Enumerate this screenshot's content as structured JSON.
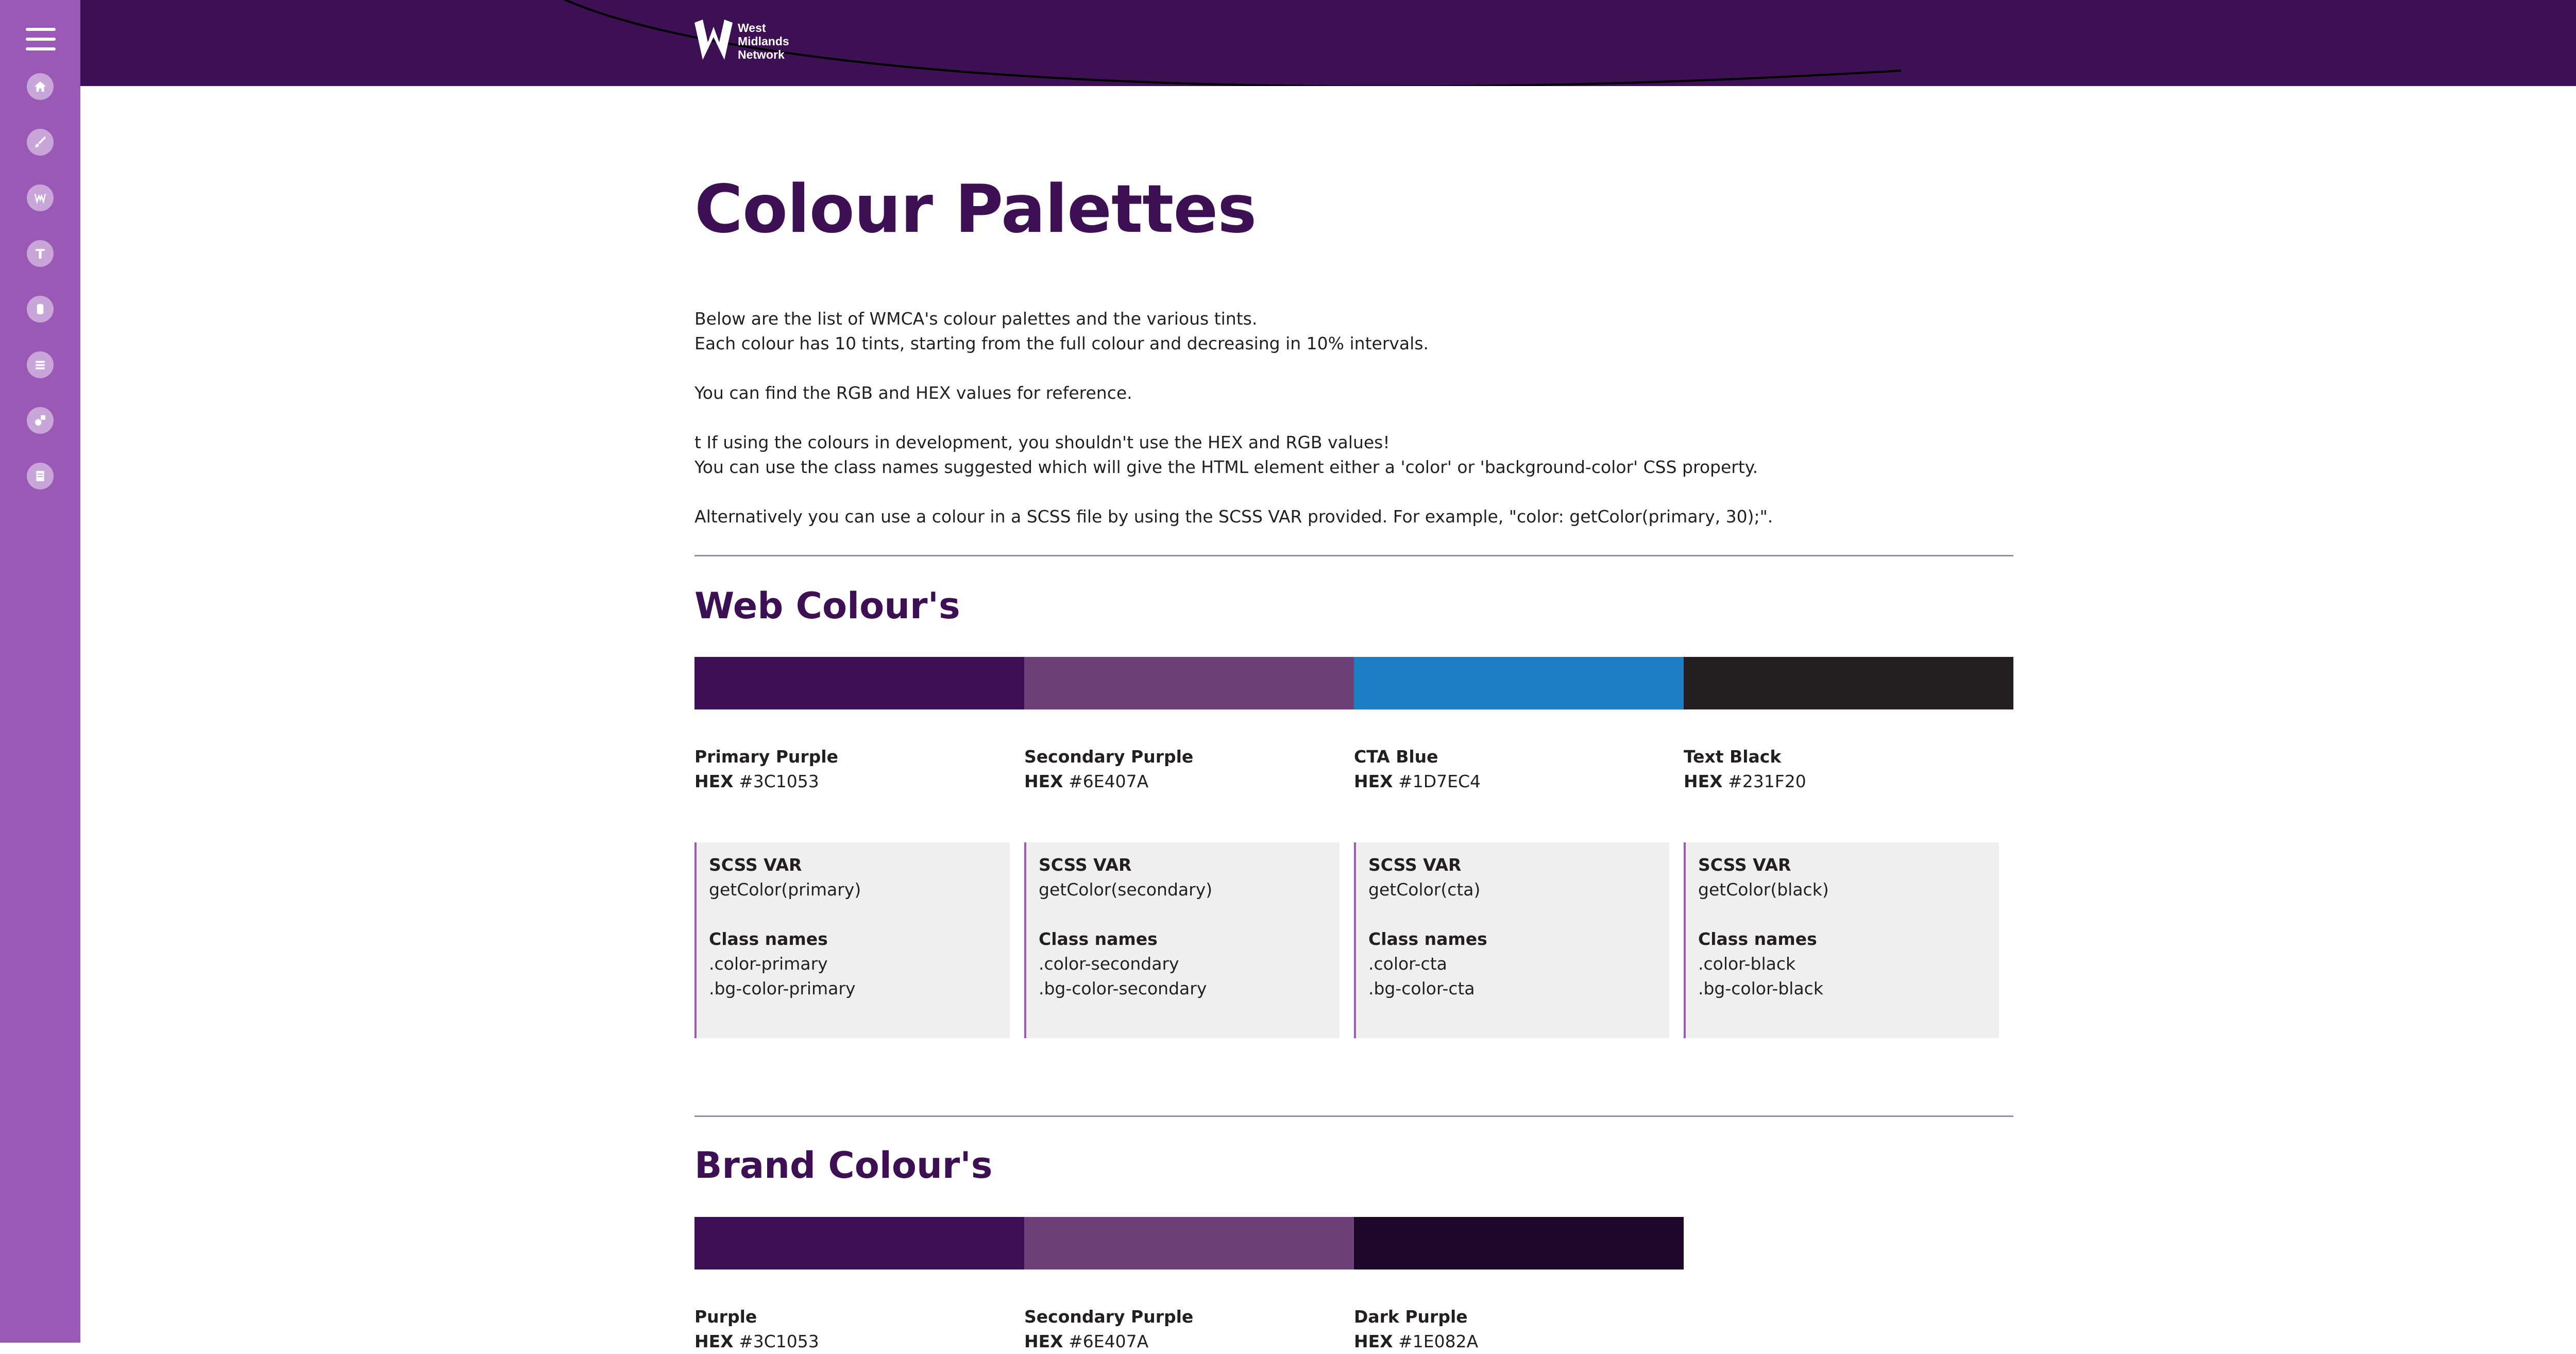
{
  "brand": {
    "line1": "West",
    "line2": "Midlands",
    "line3": "Network"
  },
  "sidebar": {
    "menu_icon": "hamburger-icon",
    "icons": [
      "home-icon",
      "brush-icon",
      "logo-icon",
      "typography-icon",
      "component-icon",
      "layout-icon",
      "icon-set-icon",
      "document-icon"
    ]
  },
  "devices": [
    "mobile-icon",
    "tablet-icon",
    "laptop-icon",
    "desktop-icon"
  ],
  "page": {
    "title": "Colour Palettes",
    "intro": [
      "Below are the list of WMCA's colour palettes and the various tints.",
      "Each colour has 10 tints, starting from the full colour and decreasing in 10% intervals.",
      "You can find the RGB and HEX values for reference.",
      "t If using the colours in development, you shouldn't use the HEX and RGB values!",
      "You can use the class names suggested which will give the HTML element either a 'color' or 'background-color' CSS property.",
      "Alternatively you can use a colour in a SCSS file by using the SCSS VAR provided. For example, \"color: getColor(primary, 30);\"."
    ]
  },
  "labels": {
    "hex": "HEX",
    "scss_var": "SCSS VAR",
    "class_names": "Class names"
  },
  "web": {
    "heading": "Web Colour's",
    "colors": [
      {
        "name": "Primary Purple",
        "hex": "#3C1053",
        "scss": "getColor(primary)",
        "class1": ".color-primary",
        "class2": ".bg-color-primary"
      },
      {
        "name": "Secondary Purple",
        "hex": "#6E407A",
        "scss": "getColor(secondary)",
        "class1": ".color-secondary",
        "class2": ".bg-color-secondary"
      },
      {
        "name": "CTA Blue",
        "hex": "#1D7EC4",
        "scss": "getColor(cta)",
        "class1": ".color-cta",
        "class2": ".bg-color-cta"
      },
      {
        "name": "Text Black",
        "hex": "#231F20",
        "scss": "getColor(black)",
        "class1": ".color-black",
        "class2": ".bg-color-black"
      }
    ]
  },
  "brand_section": {
    "heading": "Brand Colour's",
    "colors": [
      {
        "name": "Purple",
        "hex": "#3C1053"
      },
      {
        "name": "Secondary Purple",
        "hex": "#6E407A"
      },
      {
        "name": "Dark Purple",
        "hex": "#1E082A"
      }
    ]
  },
  "theme": {
    "sidebar": "#9B59B6",
    "header": "#3C1053",
    "panel": "#EFEFEF"
  }
}
